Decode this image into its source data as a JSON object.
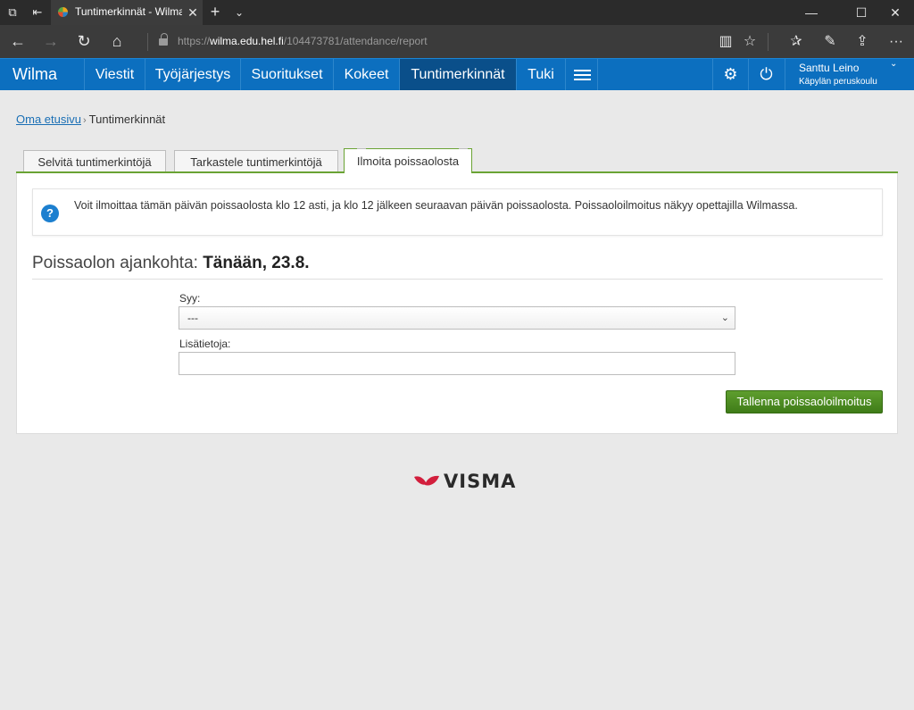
{
  "browser": {
    "tab_title": "Tuntimerkinnät - Wilma",
    "url_prefix": "https://",
    "url_host": "wilma.edu.hel.fi",
    "url_path": "/104473781/attendance/report"
  },
  "nav": {
    "brand": "Wilma",
    "items": [
      "Viestit",
      "Työjärjestys",
      "Suoritukset",
      "Kokeet",
      "Tuntimerkinnät",
      "Tuki"
    ],
    "active": "Tuntimerkinnät",
    "user_name": "Santtu Leino",
    "user_school": "Käpylän peruskoulu"
  },
  "breadcrumb": {
    "home": "Oma etusivu",
    "current": "Tuntimerkinnät"
  },
  "tabs": [
    "Selvitä tuntimerkintöjä",
    "Tarkastele tuntimerkintöjä",
    "Ilmoita poissaolosta"
  ],
  "info": {
    "text": "Voit ilmoittaa tämän päivän poissaolosta klo 12 asti, ja klo 12 jälkeen seuraavan päivän poissaolosta. Poissaoloilmoitus näkyy opettajilla Wilmassa."
  },
  "form": {
    "heading_label": "Poissaolon ajankohta:",
    "heading_value": "Tänään, 23.8.",
    "reason_label": "Syy:",
    "reason_value": "---",
    "extra_label": "Lisätietoja:",
    "extra_value": "",
    "save_label": "Tallenna poissaoloilmoitus"
  },
  "footer": {
    "logo_text": "VISMA"
  },
  "colors": {
    "nav_bg": "#0c6fbf",
    "nav_active": "#0a4f8a",
    "tab_accent": "#6aa334",
    "save_button": "#4a8a22",
    "info_icon": "#1c7fcf",
    "visma_red": "#d21e3c"
  },
  "icons": {
    "tab_manager": "tab-manager-icon",
    "set_aside": "set-aside-icon",
    "back": "back-arrow-icon",
    "forward": "forward-arrow-icon",
    "refresh": "refresh-icon",
    "home": "home-icon",
    "reading_view": "reading-view-icon",
    "favorite": "star-icon",
    "favorites_list": "favorites-icon",
    "notes": "pen-icon",
    "share": "share-icon",
    "more": "more-icon",
    "settings_user": "user-settings-icon",
    "logout": "power-icon",
    "info": "question-icon"
  }
}
